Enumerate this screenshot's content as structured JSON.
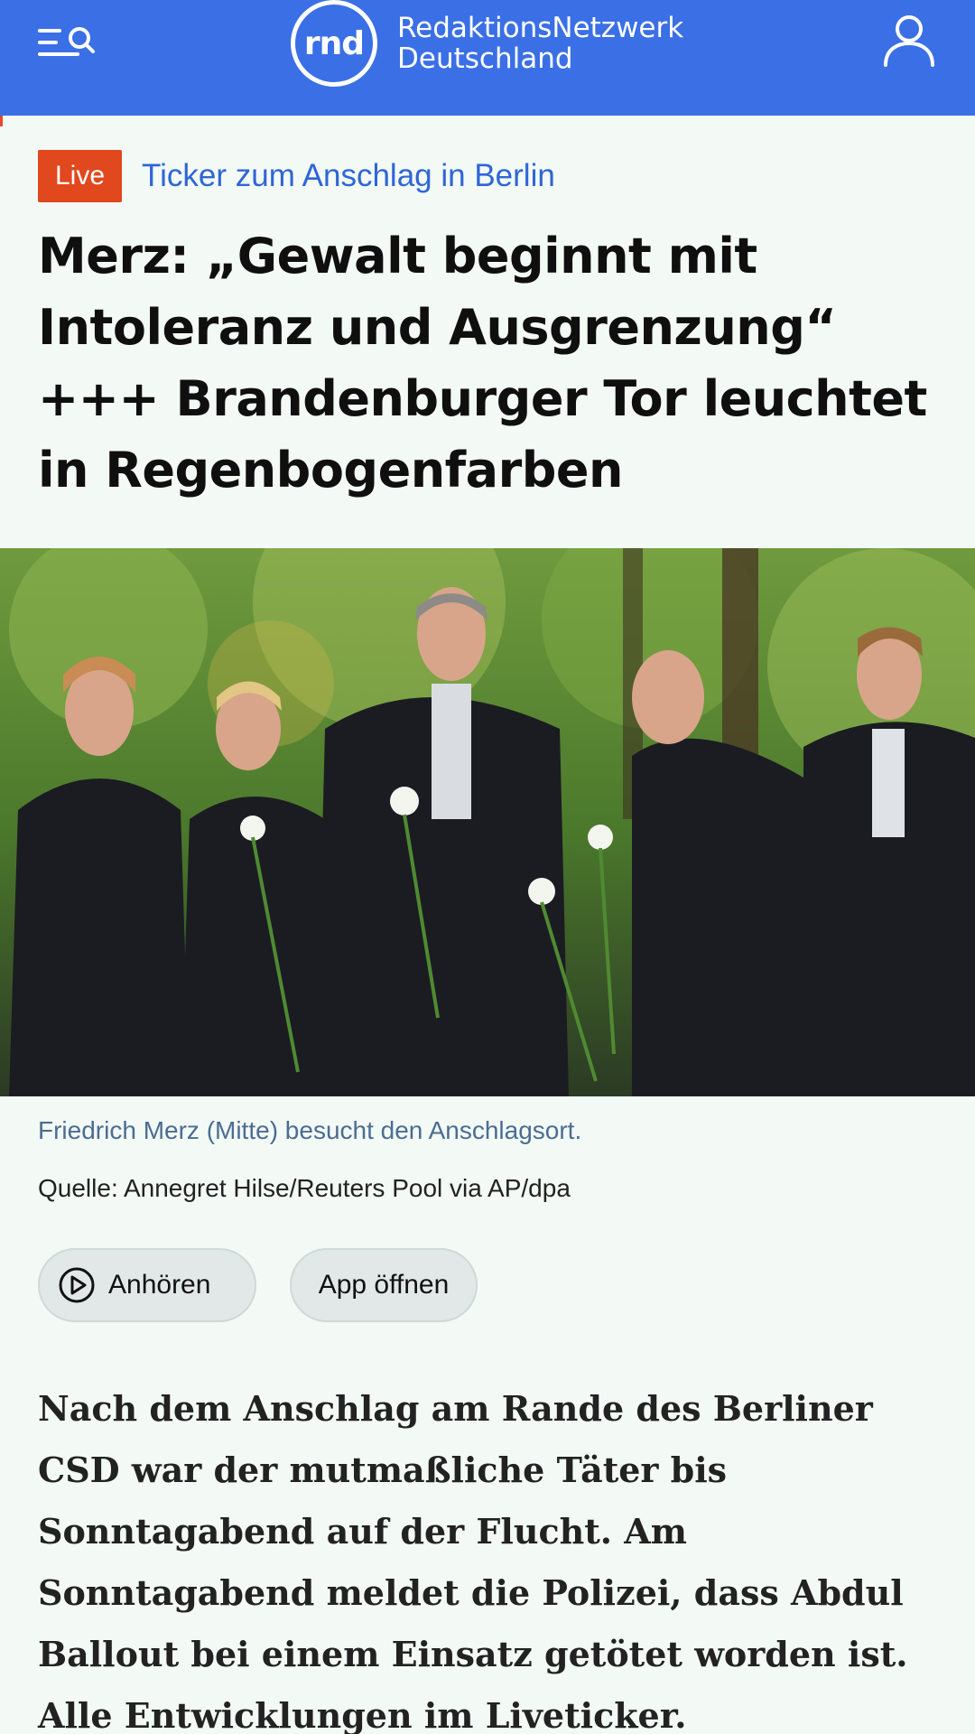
{
  "header": {
    "logo_mark": "rnd",
    "brand_line1": "RedaktionsNetzwerk",
    "brand_line2": "Deutschland",
    "brand_color": "#3a6fe6"
  },
  "icons": {
    "menu": "menu-search-icon",
    "user": "user-icon",
    "play": "play-circle-icon"
  },
  "kicker": {
    "badge": "Live",
    "badge_color": "#e1481d",
    "link": "Ticker zum Anschlag in Berlin"
  },
  "headline": "Merz: „Gewalt beginnt mit Intoleranz und Ausgrenzung“ +++ Brandenburger Tor leuchtet in Regenbogenfarben",
  "photo": {
    "caption": "Friedrich Merz (Mitte) besucht den Anschlagsort.",
    "source": "Quelle: Annegret Hilse/Reuters Pool via AP/dpa"
  },
  "actions": {
    "listen": "Anhören",
    "open_app": "App öffnen"
  },
  "lead": "Nach dem Anschlag am Rande des Berliner CSD war der mutmaßliche Täter bis Sonntagabend auf der Flucht. Am Sonntagabend meldet die Polizei, dass Abdul Ballout bei einem Einsatz getötet worden ist. Alle Entwicklungen im Liveticker."
}
